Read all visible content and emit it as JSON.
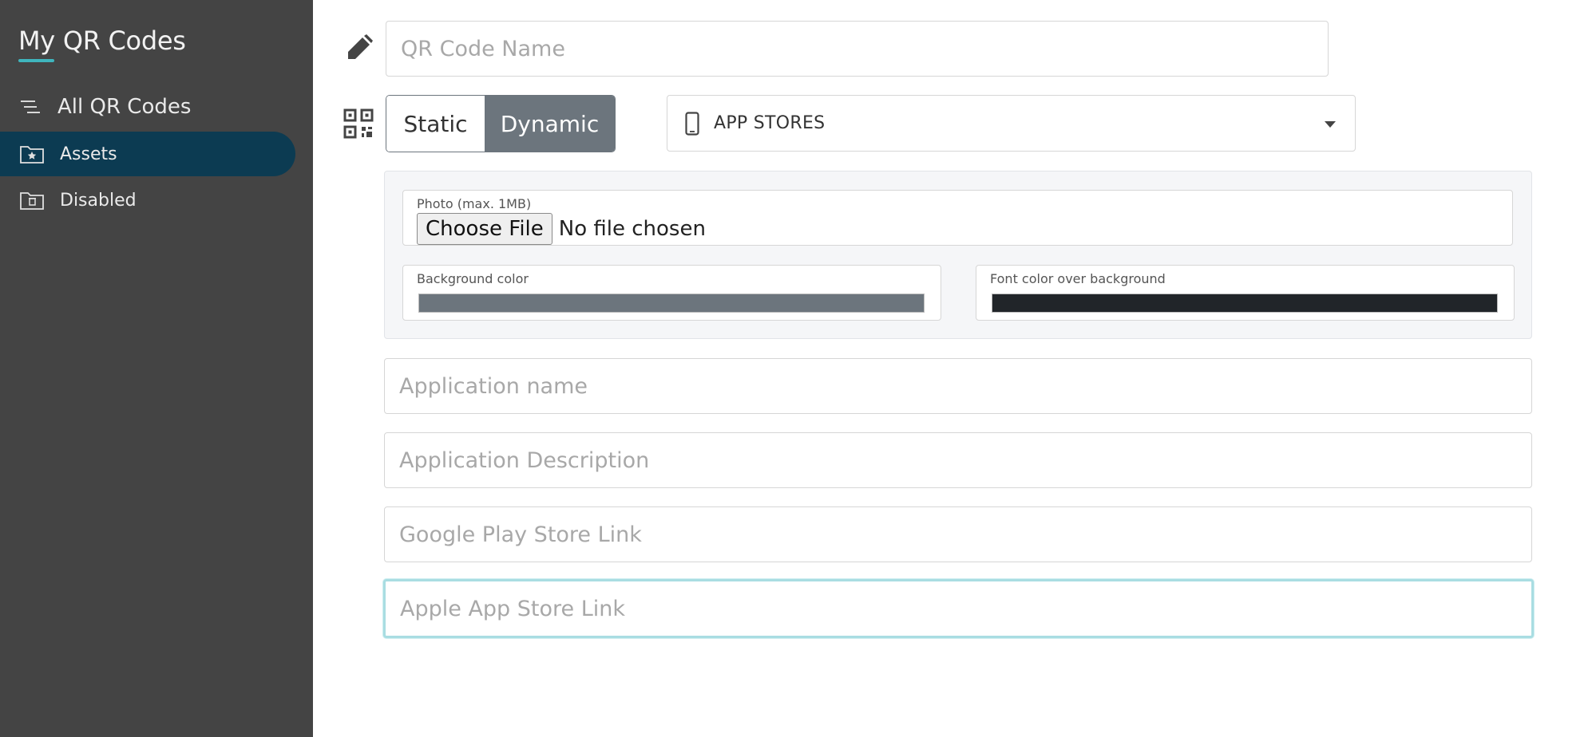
{
  "sidebar": {
    "brand": "My QR Codes",
    "items": [
      {
        "label": "All QR Codes",
        "icon": "list-icon"
      },
      {
        "label": "Assets",
        "icon": "star-folder-icon",
        "active": true
      },
      {
        "label": "Disabled",
        "icon": "trash-folder-icon"
      }
    ]
  },
  "form": {
    "name_placeholder": "QR Code Name",
    "type_toggle": {
      "static_label": "Static",
      "dynamic_label": "Dynamic",
      "selected": "Dynamic"
    },
    "category_select": {
      "value": "APP STORES"
    },
    "photo": {
      "label": "Photo (max. 1MB)",
      "button_label": "Choose File",
      "status": "No file chosen"
    },
    "background_color": {
      "label": "Background color",
      "value": "#6c757d"
    },
    "font_color": {
      "label": "Font color over background",
      "value": "#212529"
    },
    "app_name_placeholder": "Application name",
    "app_description_placeholder": "Application Description",
    "google_play_placeholder": "Google Play Store Link",
    "apple_store_placeholder": "Apple App Store Link"
  },
  "colors": {
    "sidebar_bg": "#444444",
    "active_item_bg": "#0c3b52",
    "accent": "#3fb5bd",
    "toggle_active": "#6c757d"
  }
}
